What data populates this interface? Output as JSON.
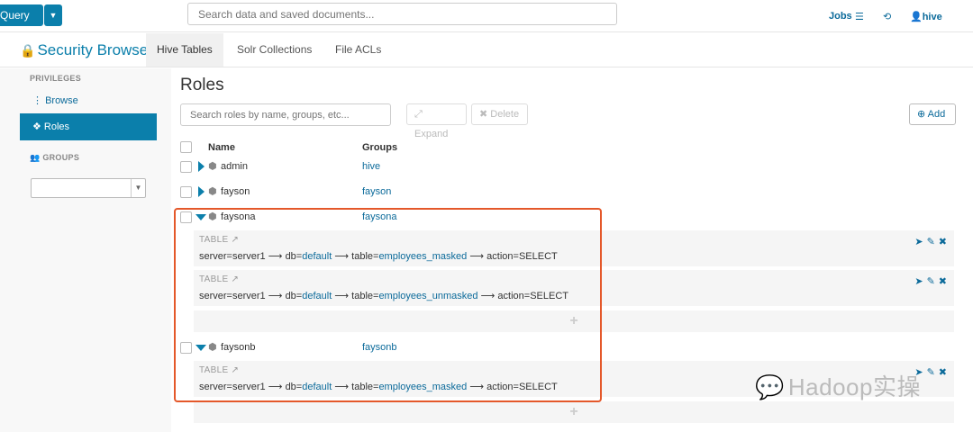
{
  "topbar": {
    "query_label": "Query",
    "search_placeholder": "Search data and saved documents...",
    "jobs_label": "Jobs",
    "user_label": "hive"
  },
  "app": {
    "title": "Security Browser",
    "tabs": [
      {
        "label": "Hive Tables",
        "active": true
      },
      {
        "label": "Solr Collections",
        "active": false
      },
      {
        "label": "File ACLs",
        "active": false
      }
    ]
  },
  "sidebar": {
    "privileges_heading": "PRIVILEGES",
    "items": [
      {
        "label": "Browse",
        "active": false
      },
      {
        "label": "Roles",
        "active": true
      }
    ],
    "groups_heading": "GROUPS",
    "groups_select_value": ""
  },
  "main": {
    "title": "Roles",
    "search_placeholder": "Search roles by name, groups, etc...",
    "expand_label": "Expand",
    "delete_label": "Delete",
    "add_label": "Add",
    "columns": {
      "name": "Name",
      "groups": "Groups"
    },
    "roles": [
      {
        "name": "admin",
        "groups": "hive",
        "expanded": false
      },
      {
        "name": "fayson",
        "groups": "fayson",
        "expanded": false
      },
      {
        "name": "faysona",
        "groups": "faysona",
        "expanded": true,
        "privileges": [
          {
            "type": "TABLE",
            "server": "server1",
            "db": "default",
            "table": "employees_masked",
            "action": "SELECT"
          },
          {
            "type": "TABLE",
            "server": "server1",
            "db": "default",
            "table": "employees_unmasked",
            "action": "SELECT"
          }
        ]
      },
      {
        "name": "faysonb",
        "groups": "faysonb",
        "expanded": true,
        "privileges": [
          {
            "type": "TABLE",
            "server": "server1",
            "db": "default",
            "table": "employees_masked",
            "action": "SELECT"
          }
        ]
      }
    ],
    "add_privilege_symbol": "+"
  },
  "watermark": {
    "text": "Hadoop实操"
  },
  "colors": {
    "accent": "#0b7fab",
    "highlight": "#e4582a"
  }
}
